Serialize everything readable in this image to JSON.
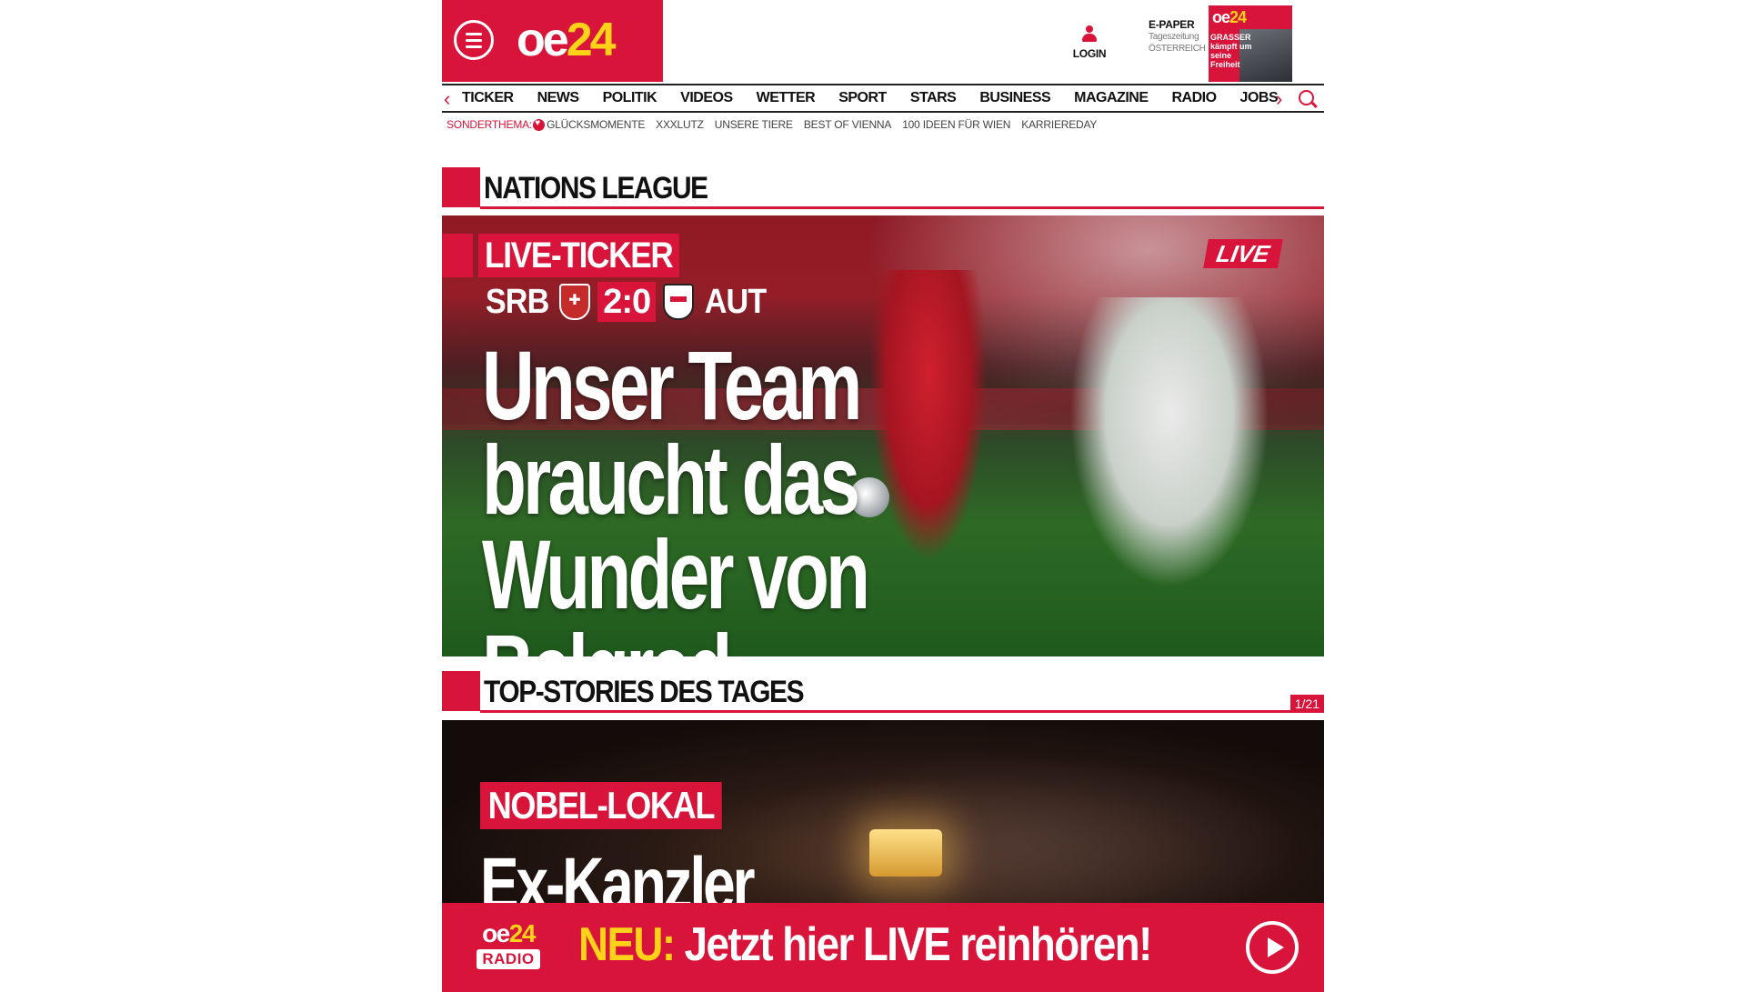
{
  "header": {
    "logo_oe": "oe",
    "logo_num": "24",
    "login_label": "LOGIN",
    "epaper_title": "E-PAPER",
    "epaper_sub1": "Tageszeitung",
    "epaper_sub2": "ÖSTERREICH",
    "epaper_cover_logo_a": "oe",
    "epaper_cover_logo_b": "24",
    "epaper_cover_text": "GRASSER kämpft um seine Freiheit"
  },
  "nav": {
    "items": [
      "TICKER",
      "NEWS",
      "POLITIK",
      "VIDEOS",
      "WETTER",
      "SPORT",
      "STARS",
      "BUSINESS",
      "MAGAZINE",
      "RADIO",
      "JOBS"
    ]
  },
  "subnav": {
    "label": "SONDERTHEMA:",
    "items": [
      "GLÜCKSMOMENTE",
      "XXXLUTZ",
      "UNSERE TIERE",
      "BEST OF VIENNA",
      "100 IDEEN FÜR WIEN",
      "KARRIEREDAY"
    ]
  },
  "section_nations": {
    "title": "NATIONS LEAGUE"
  },
  "hero": {
    "tag": "LIVE-TICKER",
    "live_badge": "LIVE",
    "team_home": "SRB",
    "score": "2:0",
    "team_away": "AUT",
    "headline_line1": "Unser Team",
    "headline_line2": "braucht das",
    "headline_line3": "Wunder von Belgrad"
  },
  "section_top": {
    "title": "TOP-STORIES DES TAGES",
    "counter": "1/21"
  },
  "story": {
    "tag": "NOBEL-LOKAL",
    "headline": "Ex-Kanzler"
  },
  "radio_banner": {
    "logo_oe": "oe",
    "logo_num": "24",
    "logo_tag": "RADIO",
    "accent": "NEU:",
    "text": " Jetzt hier LIVE reinhören!"
  },
  "colors": {
    "brand_red": "#d8143a",
    "brand_yellow": "#ffd21a"
  }
}
